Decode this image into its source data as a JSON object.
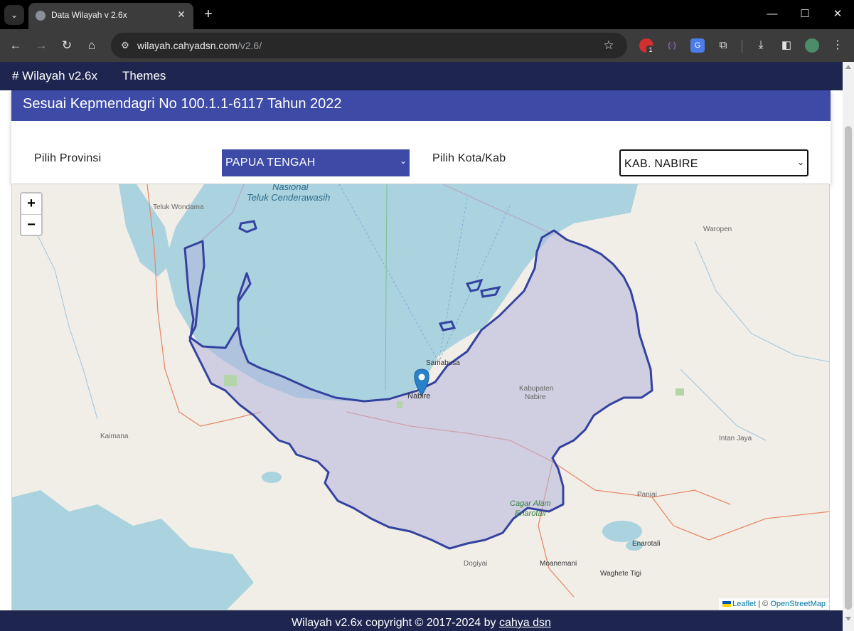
{
  "browser": {
    "tab_title": "Data Wilayah v 2.6x",
    "url_host": "wilayah.cahyadsn.com",
    "url_path": "/v2.6/",
    "extension_badge": "1"
  },
  "navbar": {
    "brand": "# Wilayah v2.6x",
    "themes_label": "Themes"
  },
  "card": {
    "title": "Sesuai Kepmendagri No 100.1.1-6117 Tahun 2022",
    "provinsi_label": "Pilih Provinsi",
    "provinsi_value": "PAPUA TENGAH",
    "kab_label": "Pilih Kota/Kab",
    "kab_value": "KAB. NABIRE"
  },
  "map": {
    "zoom_in": "+",
    "zoom_out": "−",
    "attribution_leaflet": "Leaflet",
    "attribution_sep": "| ©",
    "attribution_osm": "OpenStreetMap",
    "labels": {
      "teluk_wondama": "Teluk Wondama",
      "nasional": "Nasional",
      "teluk_cenderawasih": "Teluk Cenderawasih",
      "waropen": "Waropen",
      "samabusa": "Samabusa",
      "nabire": "Nabire",
      "kabupaten": "Kabupaten",
      "kabupaten_nabire": "Nabire",
      "kaimana": "Kaimana",
      "intan_jaya": "Intan Jaya",
      "paniai": "Paniai",
      "cagar_alam": "Cagar Alam",
      "enarotali_park": "Enarotali",
      "enarotali": "Enarotali",
      "dogiyai": "Dogiyai",
      "moanemani": "Moanemani",
      "waghete": "Waghete Tigi"
    },
    "colors": {
      "land": "#f1eee8",
      "sea": "#aad3df",
      "region_fill": "#b4b6dd",
      "region_stroke": "#3442a0",
      "marker": "#2a81cb"
    }
  },
  "footer": {
    "text": "Wilayah v2.6x copyright © 2017-2024 by ",
    "author": "cahya dsn"
  }
}
